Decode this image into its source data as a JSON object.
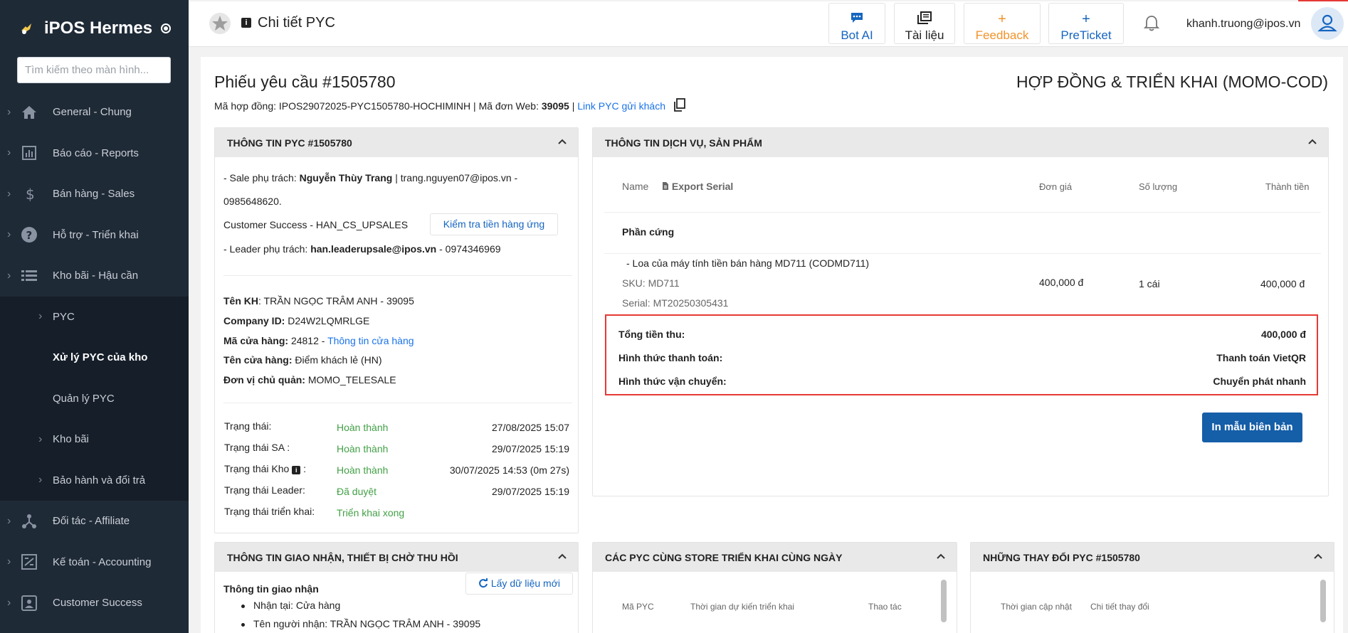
{
  "sidebar": {
    "brand": "iPOS Hermes",
    "search_placeholder": "Tìm kiếm theo màn hình...",
    "items": [
      {
        "label": "General - Chung",
        "icon": "home-icon"
      },
      {
        "label": "Báo cáo - Reports",
        "icon": "report-icon"
      },
      {
        "label": "Bán hàng - Sales",
        "icon": "dollar-icon"
      },
      {
        "label": "Hỗ trợ - Triển khai",
        "icon": "help-icon"
      },
      {
        "label": "Kho bãi - Hậu cần",
        "icon": "list-icon"
      }
    ],
    "sub_items": [
      {
        "label": "PYC"
      },
      {
        "label": "Xử lý PYC của kho"
      },
      {
        "label": "Quản lý PYC"
      },
      {
        "label": "Kho bãi"
      },
      {
        "label": "Bảo hành và đổi trả"
      }
    ],
    "items_after": [
      {
        "label": "Đối tác - Affiliate",
        "icon": "affiliate-icon"
      },
      {
        "label": "Kế toán - Accounting",
        "icon": "accounting-icon"
      },
      {
        "label": "Customer Success",
        "icon": "customer-icon"
      }
    ]
  },
  "header": {
    "page_title": "Chi tiết PYC",
    "buttons": {
      "bot_ai": "Bot AI",
      "tai_lieu": "Tài liệu",
      "feedback": "Feedback",
      "preticket": "PreTicket"
    },
    "user_email": "khanh.truong@ipos.vn"
  },
  "request": {
    "title": "Phiếu yêu cầu #1505780",
    "contract_label": "Mã hợp đồng:",
    "contract_code": "IPOS29072025-PYC1505780-HOCHIMINH",
    "web_order_label": "| Mã đơn Web:",
    "web_order_code": "39095",
    "separator": "|",
    "link_text": "Link PYC gửi khách",
    "contract_type": "HỢP ĐỒNG & TRIỂN KHAI (MOMO-COD)"
  },
  "info_panel": {
    "title": "THÔNG TIN PYC #1505780",
    "sale_prefix": "- Sale phụ trách:",
    "sale_name": "Nguyễn Thùy Trang",
    "sale_contact": "| trang.nguyen07@ipos.vn -",
    "sale_phone": "0985648620.",
    "cs_line": "Customer Success - HAN_CS_UPSALES",
    "check_button": "Kiểm tra tiền hàng ứng",
    "leader_prefix": "- Leader phụ trách:",
    "leader_email": "han.leaderupsale@ipos.vn",
    "leader_phone": "- 0974346969",
    "customer_label": "Tên KH",
    "customer_value": ": TRẦN NGỌC TRÂM ANH - 39095",
    "company_label": "Company ID:",
    "company_value": "D24W2LQMRLGE",
    "store_code_label": "Mã cửa hàng:",
    "store_code_value": "24812 -",
    "store_info_link": "Thông tin cửa hàng",
    "store_name_label": "Tên cửa hàng:",
    "store_name_value": "Điểm khách lẻ (HN)",
    "unit_label": "Đơn vị chủ quản:",
    "unit_value": "MOMO_TELESALE",
    "statuses": [
      {
        "label": "Trạng thái:",
        "value": "Hoàn thành",
        "time": "27/08/2025 15:07"
      },
      {
        "label": "Trạng thái SA :",
        "value": "Hoàn thành",
        "time": "29/07/2025 15:19"
      },
      {
        "label": "Trạng thái Kho",
        "label_suffix": " :",
        "value": "Hoàn thành",
        "time": "30/07/2025 14:53 (0m 27s)"
      },
      {
        "label": "Trạng thái Leader:",
        "value": "Đã duyệt",
        "time": "29/07/2025 15:19"
      },
      {
        "label": "Trạng thái triển khai:",
        "value": "Triển khai xong",
        "time": ""
      }
    ]
  },
  "service_panel": {
    "title": "THÔNG TIN DỊCH VỤ, SẢN PHẨM",
    "col_name": "Name",
    "export_serial": "Export Serial",
    "col_price": "Đơn giá",
    "col_qty": "Số lượng",
    "col_total": "Thành tiền",
    "group": "Phần cứng",
    "product": {
      "name": "- Loa của máy tính tiền bán hàng MD711 (CODMD711)",
      "sku": "SKU: MD711",
      "serial": "Serial: MT20250305431",
      "price": "400,000 đ",
      "qty": "1 cái",
      "total": "400,000 đ"
    },
    "summary": [
      {
        "label": "Tổng tiền thu:",
        "value": "400,000 đ"
      },
      {
        "label": "Hình thức thanh toán:",
        "value": "Thanh toán VietQR"
      },
      {
        "label": "Hình thức vận chuyển:",
        "value": "Chuyển phát nhanh"
      }
    ],
    "print_button": "In mẫu biên bản"
  },
  "delivery_panel": {
    "title": "THÔNG TIN GIAO NHẬN, THIẾT BỊ CHỜ THU HỒI",
    "section": "Thông tin giao nhận",
    "refresh_button": "Lấy dữ liệu mới",
    "bullets": [
      "Nhận tại: Cửa hàng",
      "Tên người nhận: TRẦN NGỌC TRÂM ANH - 39095"
    ]
  },
  "same_store_panel": {
    "title": "CÁC PYC CÙNG STORE TRIỂN KHAI CÙNG NGÀY",
    "columns": [
      "Mã PYC",
      "Thời gian dự kiến triển khai",
      "Thao tác"
    ]
  },
  "changes_panel": {
    "title": "NHỮNG THAY ĐỔI PYC #1505780",
    "columns": [
      "Thời gian cập nhật",
      "Chi tiết thay đổi"
    ]
  },
  "colors": {
    "sidebar_bg": "#1f2a37",
    "accent_blue": "#1565c0",
    "success_green": "#43a047",
    "feedback_orange": "#f0932b",
    "highlight_red": "#e53935"
  }
}
